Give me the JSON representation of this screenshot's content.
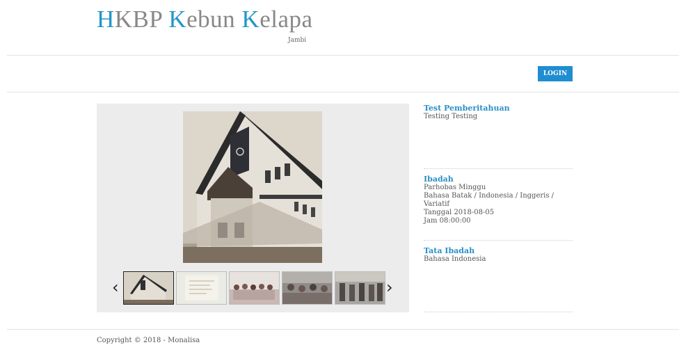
{
  "header": {
    "title_h": "H",
    "title_rest1": "KBP ",
    "title_k1": "K",
    "title_rest2": "ebun ",
    "title_k2": "K",
    "title_rest3": "elapa",
    "subtitle": "Jambi"
  },
  "nav": {
    "login_label": "LOGIN"
  },
  "slider": {
    "prev_icon": "chevron-left-icon",
    "next_icon": "chevron-right-icon",
    "prev_glyph": "‹",
    "next_glyph": "›",
    "thumbnails": [
      "church-building",
      "document",
      "congregation-group",
      "congregation-crowd",
      "congregation-meeting"
    ],
    "active_thumbnail": 0
  },
  "announcements": [
    {
      "title": "Test Pemberitahuan",
      "lines": [
        "Testing Testing"
      ]
    },
    {
      "title": "Ibadah",
      "lines": [
        "Parhobas Minggu",
        "Bahasa Batak / Indonesia / Inggeris / Variatif",
        "Tanggal 2018-08-05",
        "Jam 08:00:00"
      ]
    },
    {
      "title": "Tata Ibadah",
      "lines": [
        "Bahasa Indonesia"
      ]
    }
  ],
  "footer": {
    "copyright": "Copyright © 2018 - Monalisa"
  },
  "colors": {
    "accent": "#2196c9",
    "button": "#1f8dd1"
  }
}
